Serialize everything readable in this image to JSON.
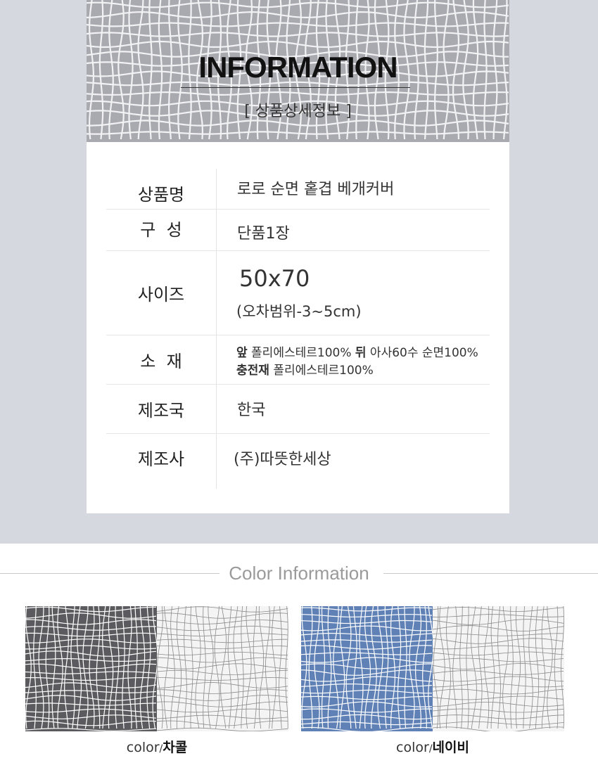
{
  "info": {
    "title": "INFORMATION",
    "subtitle": "[ 상품상세정보 ]",
    "rows": [
      {
        "label": "상품명",
        "value": "로로 순면 홑겹 베개커버"
      },
      {
        "label": "구  성",
        "value": "단품1장"
      },
      {
        "label": "사이즈",
        "value_main": "50x70",
        "value_note": "(오차범위-3~5cm)"
      },
      {
        "label": "소  재",
        "line1_a_bold": "앞",
        "line1_a": " 폴리에스테르100% ",
        "line1_b_bold": "뒤",
        "line1_b": " 아사60수 순면100%",
        "line2_bold": "충전재",
        "line2": " 폴리에스테르100%"
      },
      {
        "label": "제조국",
        "value": "한국"
      },
      {
        "label": "제조사",
        "value": "(주)따뜻한세상"
      }
    ]
  },
  "colors": {
    "heading": "Color Information",
    "prefix": "color",
    "separator": "/",
    "options": [
      {
        "name": "차콜",
        "main_color": "#5b5b5f",
        "line_color": "#ffffff"
      },
      {
        "name": "네이비",
        "main_color": "#5f81b6",
        "line_color": "#ffffff"
      }
    ],
    "light_fabric_color": "#f4f4f4",
    "light_fabric_line": "#8a8a8a"
  },
  "theme": {
    "header_pattern_bg": "#a9a9b0",
    "header_pattern_line": "#f2f2f4"
  }
}
